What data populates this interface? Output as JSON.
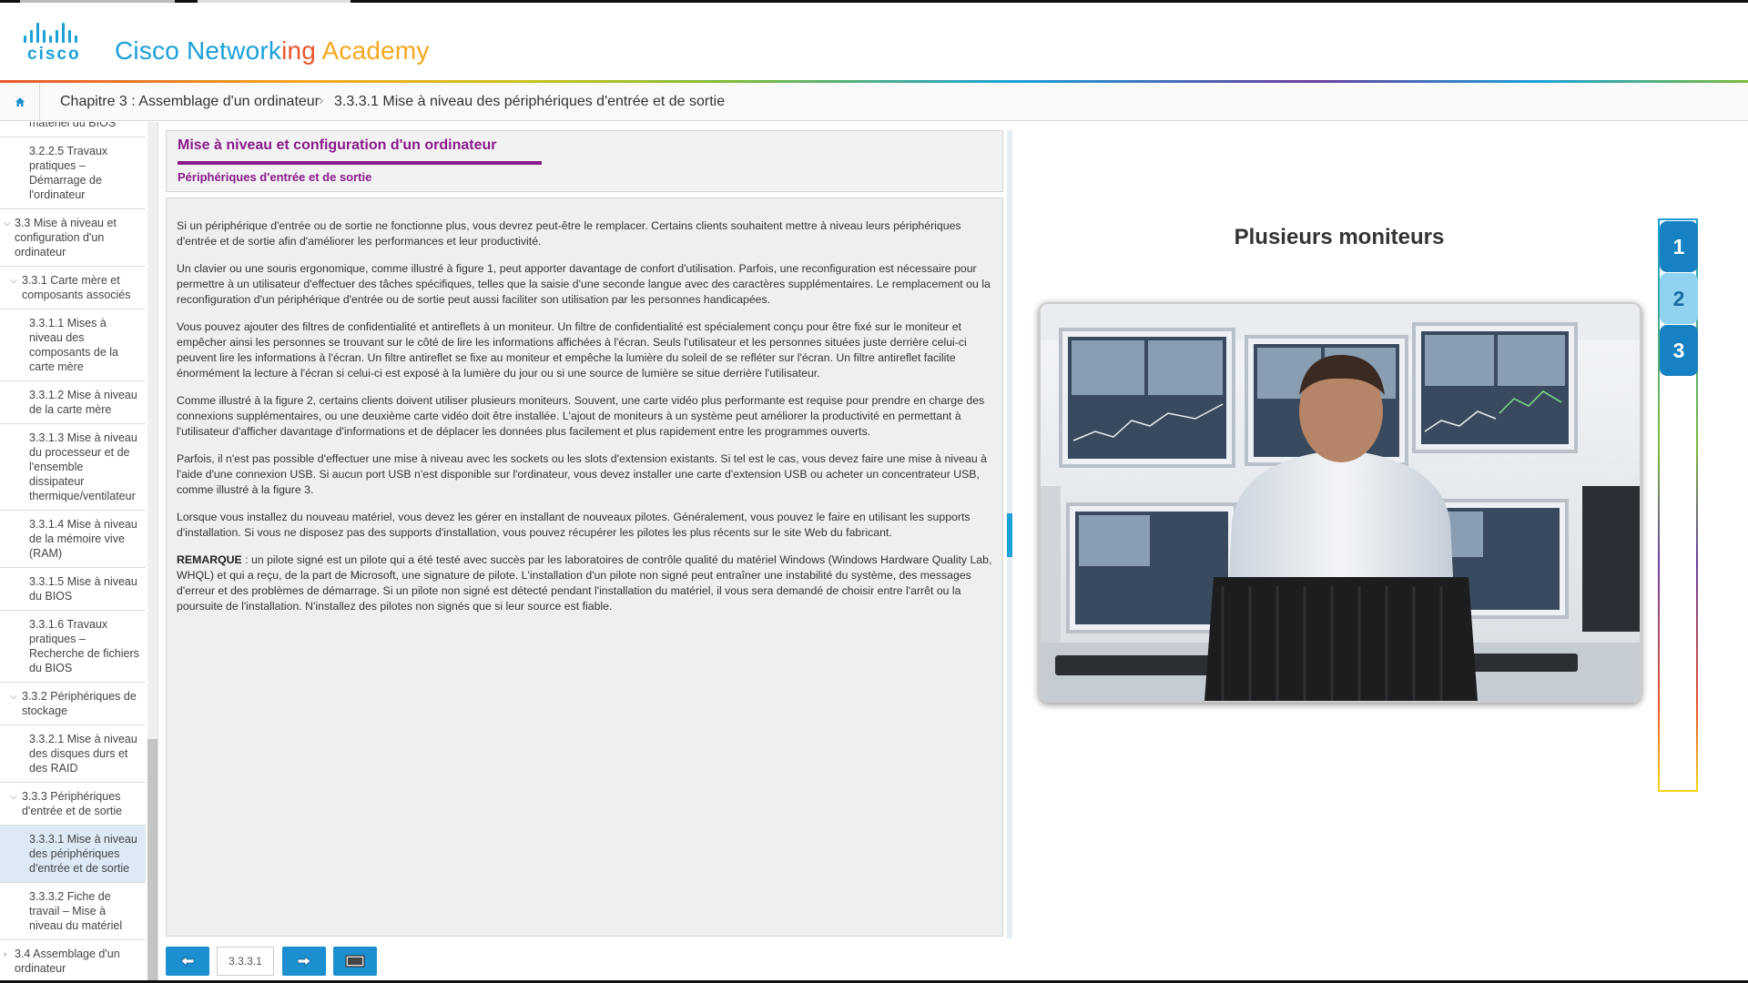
{
  "brand": {
    "logo_word": "cisco",
    "title_part1": "Cisco Network",
    "title_part2": "ing",
    "title_part3": " Academy",
    "colors": {
      "cisco_blue": "#1ba0d7",
      "orange": "#e8552d",
      "yellow": "#f4a81d",
      "purple": "#8a1a8a",
      "nav_blue": "#1b8fd0"
    }
  },
  "breadcrumb": {
    "home_icon": "home-icon",
    "chapter": "Chapitre 3 : Assemblage d'un ordinateur",
    "separator": "›",
    "current": "3.3.3.1 Mise à niveau des périphériques d'entrée et de sortie"
  },
  "sidebar": {
    "items": [
      {
        "level": 3,
        "label": "matériel du BIOS",
        "chevron": ""
      },
      {
        "level": 3,
        "label": "3.2.2.5 Travaux pratiques – Démarrage de l'ordinateur",
        "chevron": ""
      },
      {
        "level": 1,
        "label": "3.3 Mise à niveau et configuration d'un ordinateur",
        "chevron": "⌵"
      },
      {
        "level": 2,
        "label": "3.3.1 Carte mère et composants associés",
        "chevron": "⌵"
      },
      {
        "level": 3,
        "label": "3.3.1.1 Mises à niveau des composants de la carte mère",
        "chevron": ""
      },
      {
        "level": 3,
        "label": "3.3.1.2 Mise à niveau de la carte mère",
        "chevron": ""
      },
      {
        "level": 3,
        "label": "3.3.1.3 Mise à niveau du processeur et de l'ensemble dissipateur thermique/ventilateur",
        "chevron": ""
      },
      {
        "level": 3,
        "label": "3.3.1.4 Mise à niveau de la mémoire vive (RAM)",
        "chevron": ""
      },
      {
        "level": 3,
        "label": "3.3.1.5 Mise à niveau du BIOS",
        "chevron": ""
      },
      {
        "level": 3,
        "label": "3.3.1.6 Travaux pratiques – Recherche de fichiers du BIOS",
        "chevron": ""
      },
      {
        "level": 2,
        "label": "3.3.2 Périphériques de stockage",
        "chevron": "⌵"
      },
      {
        "level": 3,
        "label": "3.3.2.1 Mise à niveau des disques durs et des RAID",
        "chevron": ""
      },
      {
        "level": 2,
        "label": "3.3.3 Périphériques d'entrée et de sortie",
        "chevron": "⌵"
      },
      {
        "level": 3,
        "label": "3.3.3.1 Mise à niveau des périphériques d'entrée et de sortie",
        "chevron": "",
        "active": true
      },
      {
        "level": 3,
        "label": "3.3.3.2 Fiche de travail – Mise à niveau du matériel",
        "chevron": ""
      },
      {
        "level": 1,
        "label": "3.4 Assemblage d'un ordinateur",
        "chevron": "›"
      }
    ]
  },
  "content": {
    "title": "Mise à niveau et configuration d'un ordinateur",
    "subtitle": "Périphériques d'entrée et de sortie",
    "p1": "Si un périphérique d'entrée ou de sortie ne fonctionne plus, vous devrez peut-être le remplacer. Certains clients souhaitent mettre à niveau leurs périphériques d'entrée et de sortie afin d'améliorer les performances et leur productivité.",
    "p2": "Un clavier ou une souris ergonomique, comme illustré à figure 1, peut apporter davantage de confort d'utilisation. Parfois, une reconfiguration est nécessaire pour permettre à un utilisateur d'effectuer des tâches spécifiques, telles que la saisie d'une seconde langue avec des caractères supplémentaires. Le remplacement ou la reconfiguration d'un périphérique d'entrée ou de sortie peut aussi faciliter son utilisation par les personnes handicapées.",
    "p3": "Vous pouvez ajouter des filtres de confidentialité et antireflets à un moniteur. Un filtre de confidentialité est spécialement conçu pour être fixé sur le moniteur et empêcher ainsi les personnes se trouvant sur le côté de lire les informations affichées à l'écran. Seuls l'utilisateur et les personnes situées juste derrière celui-ci peuvent lire les informations à l'écran. Un filtre antireflet se fixe au moniteur et empêche la lumière du soleil de se refléter sur l'écran. Un filtre antireflet facilite énormément la lecture à l'écran si celui-ci est exposé à la lumière du jour ou si une source de lumière se situe derrière l'utilisateur.",
    "p4": "Comme illustré à la figure 2, certains clients doivent utiliser plusieurs moniteurs. Souvent, une carte vidéo plus performante est requise pour prendre en charge des connexions supplémentaires, ou une deuxième carte vidéo doit être installée. L'ajout de moniteurs à un système peut améliorer la productivité en permettant à l'utilisateur d'afficher davantage d'informations et de déplacer les données plus facilement et plus rapidement entre les programmes ouverts.",
    "p5": "Parfois, il n'est pas possible d'effectuer une mise à niveau avec les sockets ou les slots d'extension existants. Si tel est le cas, vous devez faire une mise à niveau à l'aide d'une connexion USB. Si aucun port USB n'est disponible sur l'ordinateur, vous devez installer une carte d'extension USB ou acheter un concentrateur USB, comme illustré à la figure 3.",
    "p6": "Lorsque vous installez du nouveau matériel, vous devez les gérer en installant de nouveaux pilotes. Généralement, vous pouvez le faire en utilisant les supports d'installation. Si vous ne disposez pas des supports d'installation, vous pouvez récupérer les pilotes les plus récents sur le site Web du fabricant.",
    "note_label": "REMARQUE",
    "note_text": " : un pilote signé est un pilote qui a été testé avec succès par les laboratoires de contrôle qualité du matériel Windows (Windows Hardware Quality Lab, WHQL) et qui a reçu, de la part de Microsoft, une signature de pilote. L'installation d'un pilote non signé peut entraîner une instabilité du système, des messages d'erreur et des problèmes de démarrage. Si un pilote non signé est détecté pendant l'installation du matériel, il vous sera demandé de choisir entre l'arrêt ou la poursuite de l'installation. N'installez des pilotes non signés que si leur source est fiable."
  },
  "nav": {
    "page_number": "3.3.3.1",
    "prev_icon": "arrow-left-icon",
    "next_icon": "arrow-right-icon",
    "media_icon": "screen-icon"
  },
  "media": {
    "title": "Plusieurs moniteurs",
    "image_alt": "man-at-multiple-monitors-photo",
    "figures": [
      "1",
      "2",
      "3"
    ],
    "selected_figure": "2"
  }
}
